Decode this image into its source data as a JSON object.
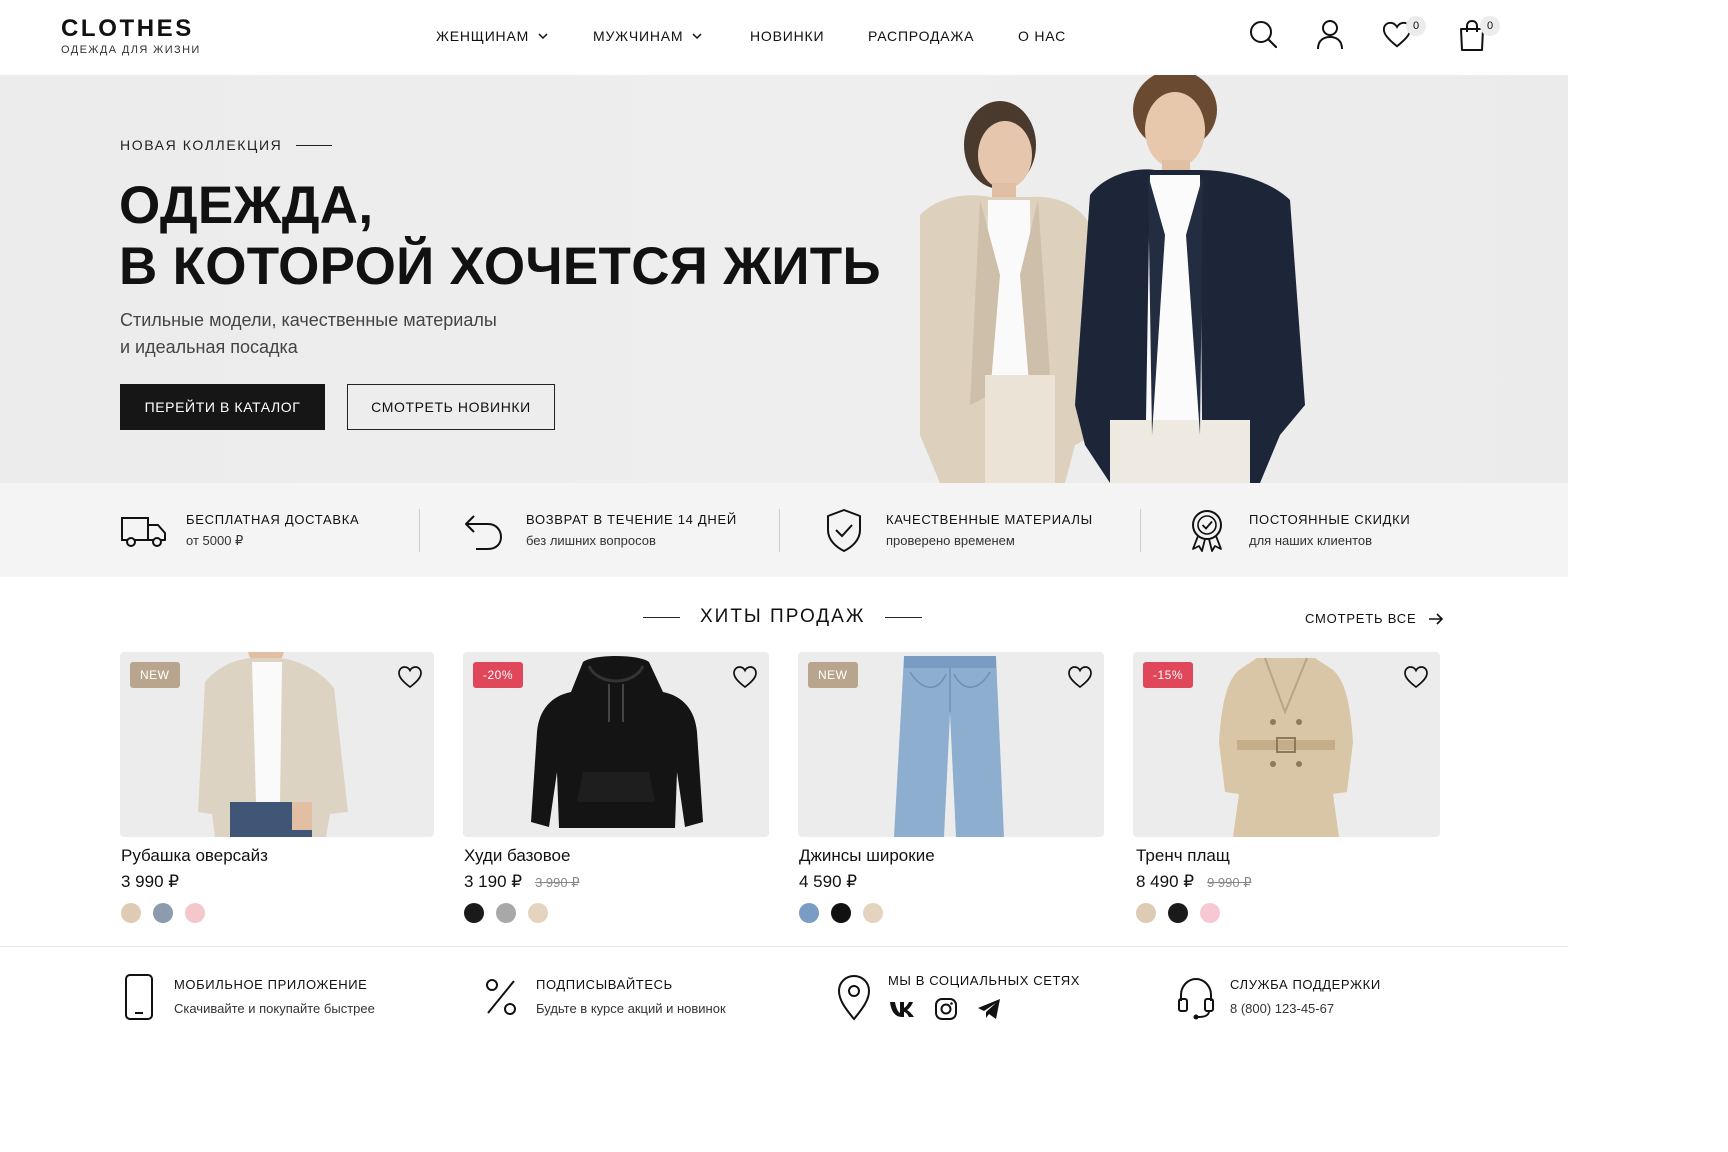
{
  "brand": {
    "name": "CLOTHES",
    "tagline": "ОДЕЖДА ДЛЯ ЖИЗНИ"
  },
  "nav": [
    {
      "label": "ЖЕНЩИНАМ",
      "has_dropdown": true
    },
    {
      "label": "МУЖЧИНАМ",
      "has_dropdown": true
    },
    {
      "label": "НОВИНКИ",
      "has_dropdown": false
    },
    {
      "label": "РАСПРОДАЖА",
      "has_dropdown": false
    },
    {
      "label": "О НАС",
      "has_dropdown": false
    }
  ],
  "header_icons": {
    "search": "search-icon",
    "account": "user-icon",
    "wishlist": {
      "icon": "heart-icon",
      "count": "0"
    },
    "cart": {
      "icon": "bag-icon",
      "count": "0"
    }
  },
  "hero": {
    "eyebrow": "НОВАЯ КОЛЛЕКЦИЯ",
    "title_line1": "ОДЕЖДА,",
    "title_line2": "В КОТОРОЙ ХОЧЕТСЯ ЖИТЬ",
    "subtitle_line1": "Стильные модели, качественные материалы",
    "subtitle_line2": "и идеальная посадка",
    "primary_button": "ПЕРЕЙТИ В КАТАЛОГ",
    "secondary_button": "СМОТРЕТЬ НОВИНКИ"
  },
  "benefits": [
    {
      "icon": "truck-icon",
      "title": "БЕСПЛАТНАЯ ДОСТАВКА",
      "subtitle": "от 5000 ₽"
    },
    {
      "icon": "return-icon",
      "title": "ВОЗВРАТ В ТЕЧЕНИЕ 14 ДНЕЙ",
      "subtitle": "без лишних вопросов"
    },
    {
      "icon": "shield-check-icon",
      "title": "КАЧЕСТВЕННЫЕ МАТЕРИАЛЫ",
      "subtitle": "проверено временем"
    },
    {
      "icon": "award-badge-icon",
      "title": "ПОСТОЯННЫЕ СКИДКИ",
      "subtitle": "для наших клиентов"
    }
  ],
  "bestsellers": {
    "title": "ХИТЫ ПРОДАЖ",
    "see_all": "СМОТРЕТЬ ВСЕ",
    "products": [
      {
        "name": "Рубашка оверсайз",
        "price": "3 990 ₽",
        "old_price": "",
        "tag": "NEW",
        "tag_color": "#b9a58d",
        "colors": [
          "#ddcbb3",
          "#8c9cad",
          "#f4c7cd"
        ]
      },
      {
        "name": "Худи базовое",
        "price": "3 190 ₽",
        "old_price": "3 990 ₽",
        "tag": "-20%",
        "tag_color": "#e0475a",
        "colors": [
          "#1a1a1a",
          "#a8a8a8",
          "#e3d3bf"
        ]
      },
      {
        "name": "Джинсы широкие",
        "price": "4 590 ₽",
        "old_price": "",
        "tag": "NEW",
        "tag_color": "#b9a58d",
        "colors": [
          "#7b9cc4",
          "#111111",
          "#e3d3bf"
        ]
      },
      {
        "name": "Тренч плащ",
        "price": "8 490 ₽",
        "old_price": "9 990 ₽",
        "tag": "-15%",
        "tag_color": "#e0475a",
        "colors": [
          "#ddcbb3",
          "#1a1a1a",
          "#f6c9d2"
        ]
      }
    ]
  },
  "footer": [
    {
      "icon": "smartphone-icon",
      "title": "МОБИЛЬНОЕ ПРИЛОЖЕНИЕ",
      "subtitle": "Скачивайте и покупайте быстрее"
    },
    {
      "icon": "percent-icon",
      "title": "ПОДПИСЫВАЙТЕСЬ",
      "subtitle": "Будьте в курсе акций и новинок"
    },
    {
      "icon": "location-pin-icon",
      "title": "МЫ В СОЦИАЛЬНЫХ СЕТЯХ",
      "social": [
        "vk-icon",
        "instagram-icon",
        "telegram-icon"
      ]
    },
    {
      "icon": "headset-icon",
      "title": "СЛУЖБА ПОДДЕРЖКИ",
      "subtitle": "8 (800) 123-45-67"
    }
  ],
  "colors": {
    "accent_dark": "#161616",
    "hero_bg": "#ededed",
    "benefits_bg": "#f4f4f4",
    "sale_tag": "#e0475a",
    "new_tag": "#b9a58d"
  }
}
